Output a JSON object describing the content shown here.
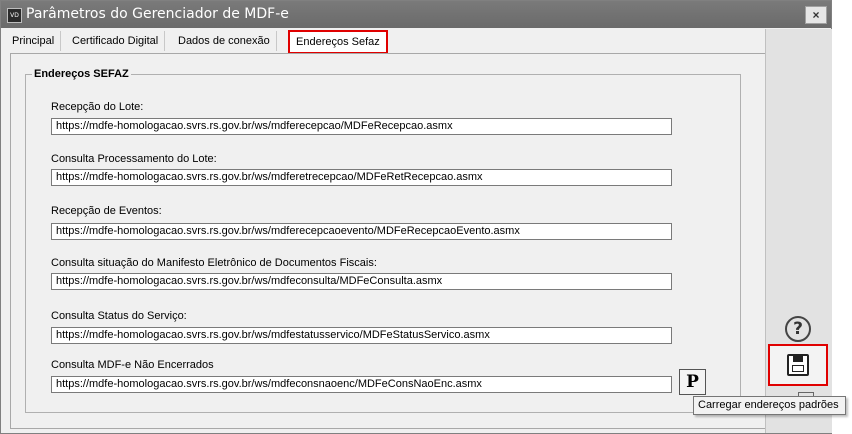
{
  "window": {
    "icon_text": "VD",
    "title": "Parâmetros do Gerenciador de MDF-e",
    "close_symbol": "×"
  },
  "tabs": [
    {
      "label": "Principal"
    },
    {
      "label": "Certificado Digital"
    },
    {
      "label": "Dados de conexão"
    },
    {
      "label": "Endereços Sefaz",
      "active": true
    }
  ],
  "group": {
    "title": "Endereços SEFAZ"
  },
  "fields": [
    {
      "label": "Recepção do Lote:",
      "value": "https://mdfe-homologacao.svrs.rs.gov.br/ws/mdferecepcao/MDFeRecepcao.asmx"
    },
    {
      "label": "Consulta Processamento do Lote:",
      "value": "https://mdfe-homologacao.svrs.rs.gov.br/ws/mdferetrecepcao/MDFeRetRecepcao.asmx"
    },
    {
      "label": "Recepção de Eventos:",
      "value": "https://mdfe-homologacao.svrs.rs.gov.br/ws/mdferecepcaoevento/MDFeRecepcaoEvento.asmx"
    },
    {
      "label": "Consulta situação do Manifesto Eletrônico de Documentos Fiscais:",
      "value": "https://mdfe-homologacao.svrs.rs.gov.br/ws/mdfeconsulta/MDFeConsulta.asmx"
    },
    {
      "label": "Consulta Status do Serviço:",
      "value": "https://mdfe-homologacao.svrs.rs.gov.br/ws/mdfestatusservico/MDFeStatusServico.asmx"
    },
    {
      "label": "Consulta MDF-e Não Encerrados",
      "value": "https://mdfe-homologacao.svrs.rs.gov.br/ws/mdfeconsnaoenc/MDFeConsNaoEnc.asmx"
    }
  ],
  "p_button": {
    "label": "P"
  },
  "tooltip": {
    "text": "Carregar endereços padrões"
  },
  "sidebar": {
    "help_symbol": "?",
    "icons": [
      "help-icon",
      "save-icon"
    ]
  },
  "colors": {
    "highlight": "#e00000",
    "titlebar": "#707070"
  }
}
